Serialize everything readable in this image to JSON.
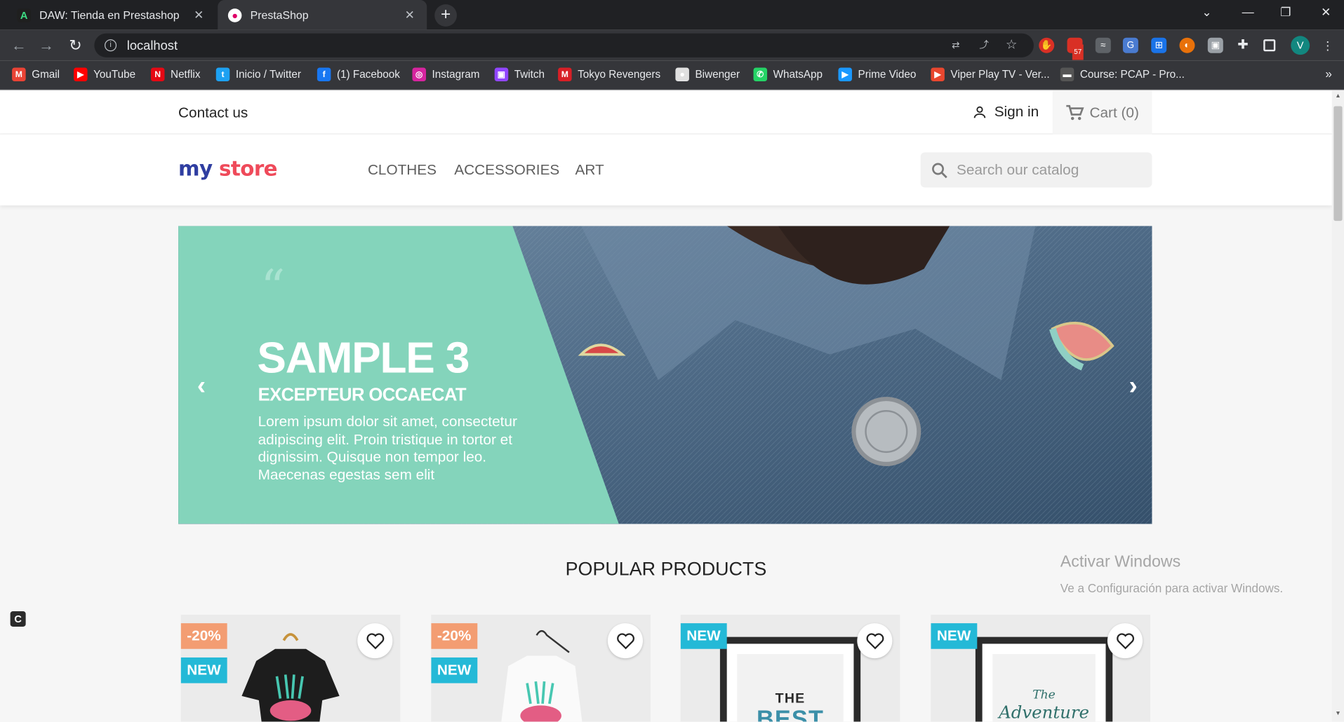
{
  "browser": {
    "tabs": [
      {
        "title": "DAW: Tienda en Prestashop",
        "icon": "android-studio-icon"
      },
      {
        "title": "PrestaShop",
        "icon": "prestashop-icon"
      }
    ],
    "url": "localhost",
    "bookmarks": [
      {
        "label": "Gmail",
        "color": "#ea4335"
      },
      {
        "label": "YouTube",
        "color": "#ff0000"
      },
      {
        "label": "Netflix",
        "color": "#e50914"
      },
      {
        "label": "Inicio / Twitter",
        "color": "#1da1f2"
      },
      {
        "label": "(1) Facebook",
        "color": "#1877f2"
      },
      {
        "label": "Instagram",
        "color": "#d6249f"
      },
      {
        "label": "Twitch",
        "color": "#9146ff"
      },
      {
        "label": "Tokyo Revengers",
        "color": "#d81f26"
      },
      {
        "label": "Biwenger",
        "color": "#e0e0e0"
      },
      {
        "label": "WhatsApp",
        "color": "#25d366"
      },
      {
        "label": "Prime Video",
        "color": "#1a98ff"
      },
      {
        "label": "Viper Play TV - Ver...",
        "color": "#e8472f"
      },
      {
        "label": "Course: PCAP - Pro...",
        "color": "#555555"
      }
    ],
    "extension_badge": "57",
    "profile_initial": "V"
  },
  "store": {
    "contact": "Contact us",
    "sign_in": "Sign in",
    "cart": "Cart (0)",
    "logo_my": "my",
    "logo_store": "store",
    "menu": [
      "Clothes",
      "Accessories",
      "Art"
    ],
    "search_placeholder": "Search our catalog",
    "slide": {
      "quote_mark": "“",
      "title": "SAMPLE 3",
      "subtitle": "EXCEPTEUR OCCAECAT",
      "text": "Lorem ipsum dolor sit amet, consectetur adipiscing elit. Proin tristique in tortor et dignissim. Quisque non tempor leo. Maecenas egestas sem elit"
    },
    "section_title": "POPULAR PRODUCTS",
    "products": [
      {
        "discount": "-20%",
        "flag": "NEW",
        "image": "black-tshirt"
      },
      {
        "discount": "-20%",
        "flag": "NEW",
        "image": "white-sweater"
      },
      {
        "flag": "NEW",
        "image": "poster-the-best",
        "poster_text_1": "THE",
        "poster_text_2": "BEST"
      },
      {
        "flag": "NEW",
        "image": "poster-adventure",
        "poster_text_1": "The",
        "poster_text_2": "Adventure"
      }
    ]
  },
  "os": {
    "watermark_title": "Activar Windows",
    "watermark_text": "Ve a Configuración para activar Windows."
  },
  "colors": {
    "teal": "#84d4bb",
    "discount": "#f39d72",
    "new_badge": "#24b9d7"
  }
}
